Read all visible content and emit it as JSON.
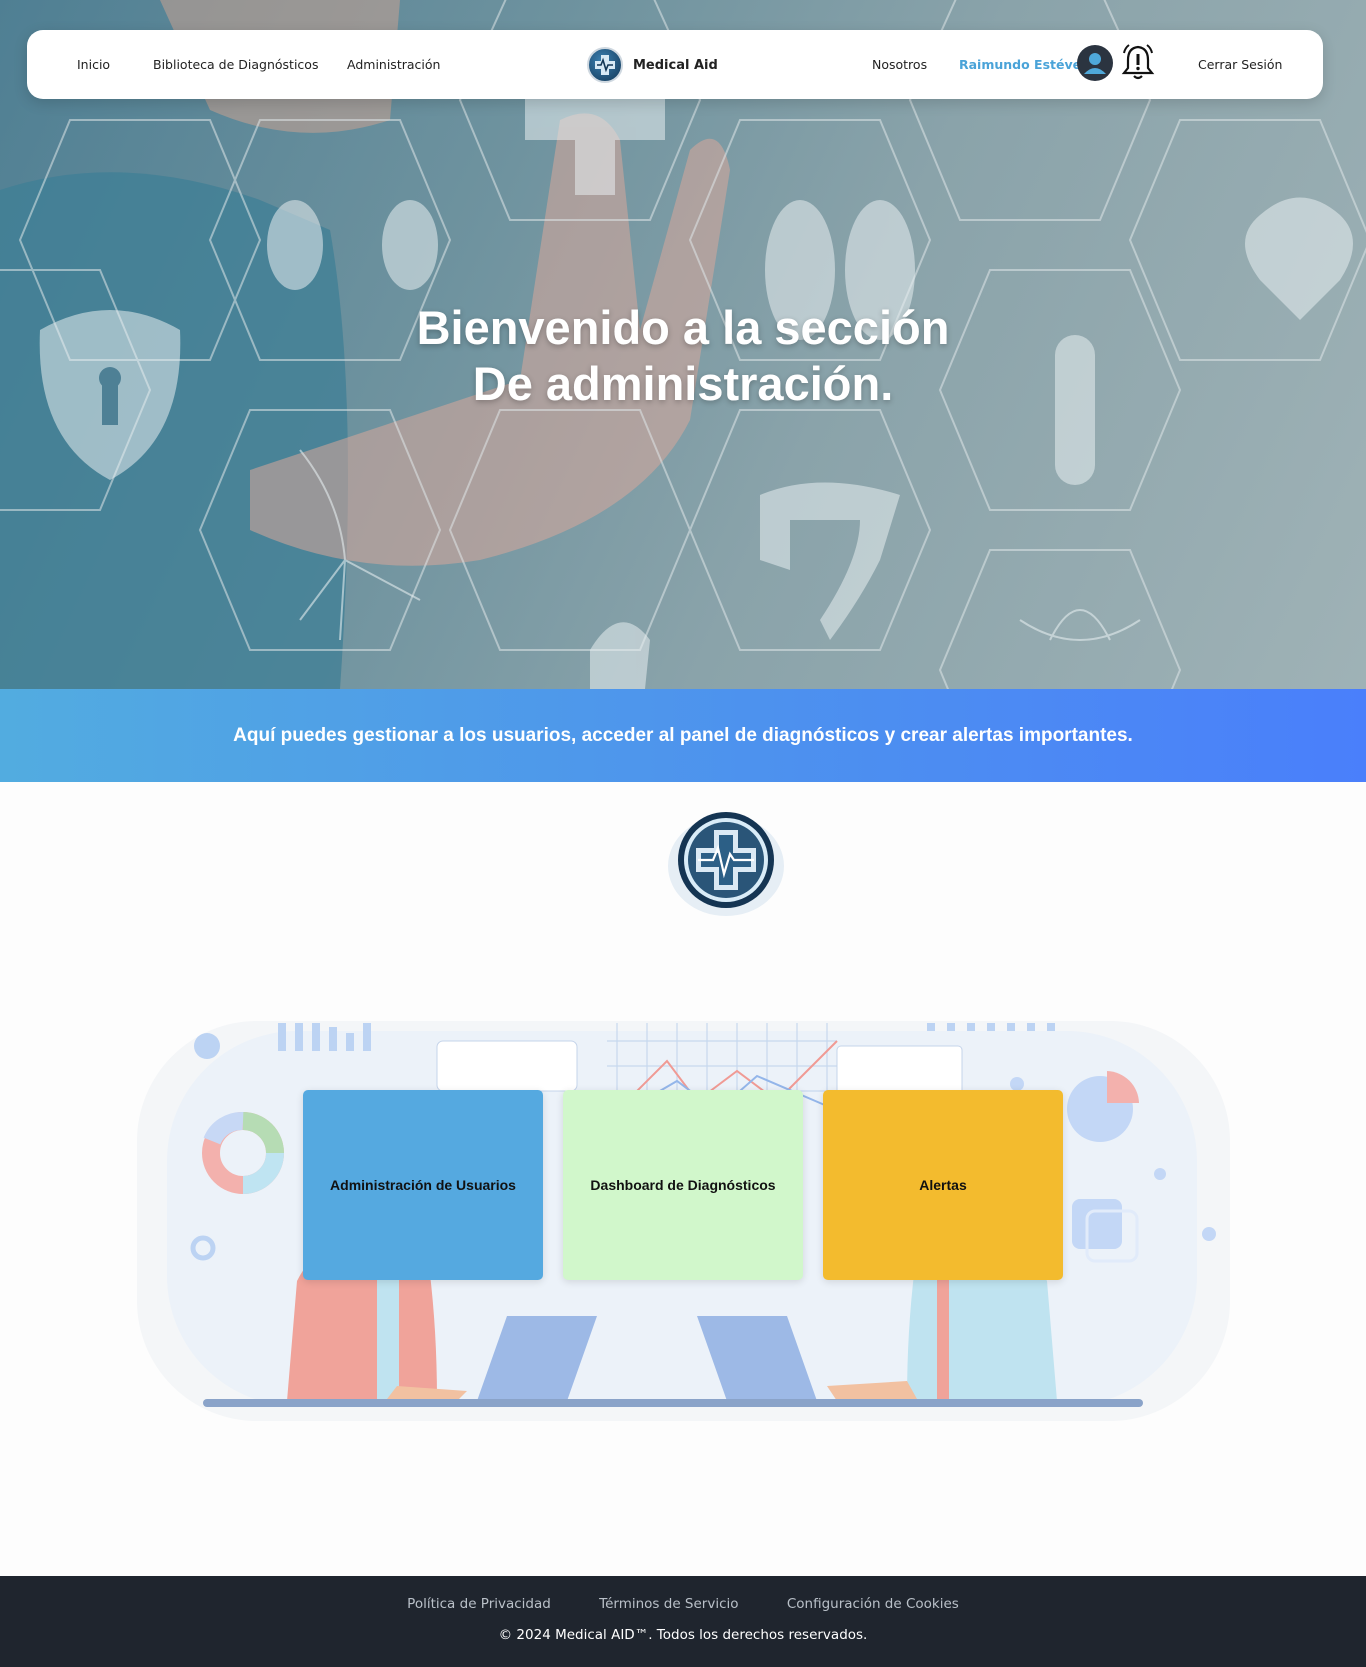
{
  "navbar": {
    "links_left": [
      "Inicio",
      "Biblioteca de Diagnósticos",
      "Administración"
    ],
    "brand": "Medical Aid",
    "link_about": "Nosotros",
    "user_name": "Raimundo Estévez",
    "logout": "Cerrar Sesión"
  },
  "hero": {
    "title_line1": "Bienvenido a la sección",
    "title_line2": "De administración."
  },
  "banner": {
    "text": "Aquí puedes gestionar a los usuarios, acceder al panel de diagnósticos y crear alertas importantes."
  },
  "cards": [
    {
      "label": "Administración de Usuarios",
      "color": "#55a9e0"
    },
    {
      "label": "Dashboard de Diagnósticos",
      "color": "#d1f7cb"
    },
    {
      "label": "Alertas",
      "color": "#f3bb2e"
    }
  ],
  "footer": {
    "links": [
      "Política de Privacidad",
      "Términos de Servicio",
      "Configuración de Cookies"
    ],
    "copyright": "© 2024 Medical AID™. Todos los derechos reservados."
  },
  "colors": {
    "accent": "#4aa3d8",
    "banner_start": "#52ace0",
    "banner_end": "#4a7ffb",
    "footer_bg": "#1f252e"
  },
  "icons": [
    "medical-cross-logo-icon",
    "user-avatar-icon",
    "bell-alert-icon"
  ]
}
